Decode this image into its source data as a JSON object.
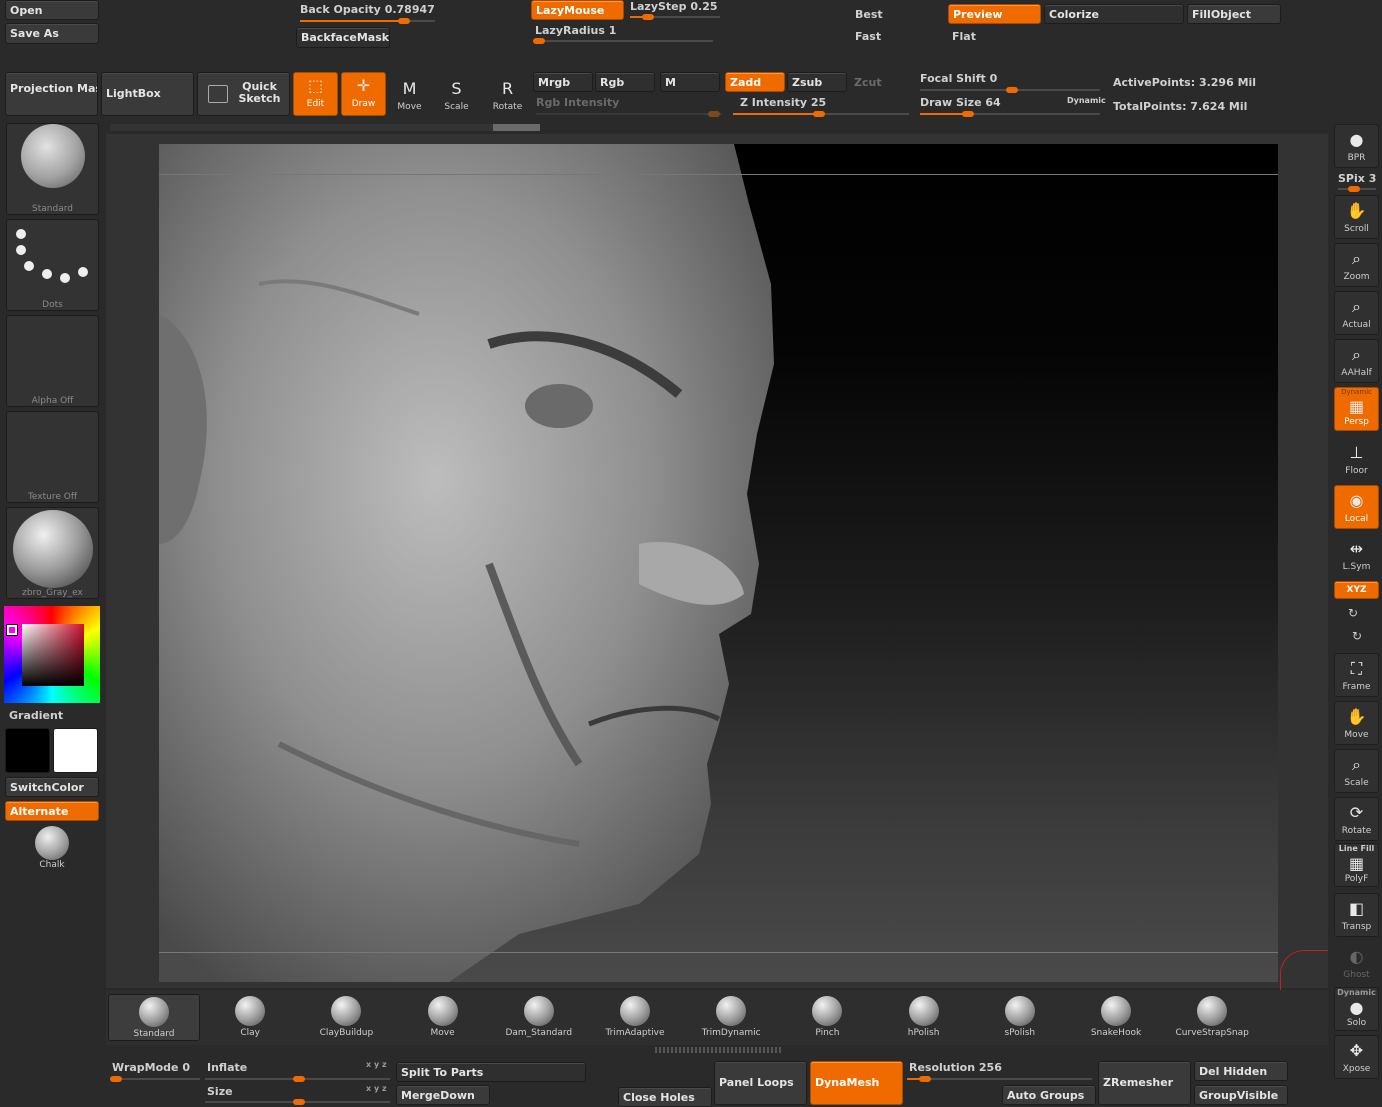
{
  "file_menu": {
    "open": "Open",
    "save_as": "Save As"
  },
  "top": {
    "back_opacity": {
      "label": "Back Opacity",
      "value": "0.78947",
      "fraction": 0.79
    },
    "backface_mask": "BackfaceMask",
    "lazymouse": "LazyMouse",
    "lazystep": {
      "label": "LazyStep",
      "value": "0.25",
      "fraction": 0.25
    },
    "lazyradius": {
      "label": "LazyRadius",
      "value": "1",
      "fraction": 0.0
    },
    "best": "Best",
    "fast": "Fast",
    "preview": "Preview",
    "flat": "Flat",
    "colorize": "Colorize",
    "fill_object": "FillObject"
  },
  "toolbar": {
    "projection_master": "Projection Master",
    "lightbox": "LightBox",
    "quick_sketch": "Quick Sketch",
    "edit": "Edit",
    "draw": "Draw",
    "move": "Move",
    "scale": "Scale",
    "rotate": "Rotate",
    "mrgb": "Mrgb",
    "rgb": "Rgb",
    "m": "M",
    "zadd": "Zadd",
    "zsub": "Zsub",
    "zcut": "Zcut",
    "rgb_intensity": "Rgb Intensity",
    "z_intensity": {
      "label": "Z Intensity",
      "value": "25",
      "fraction": 0.25
    },
    "focal_shift": {
      "label": "Focal Shift",
      "value": "0",
      "fraction": 0.5
    },
    "draw_size": {
      "label": "Draw Size",
      "value": "64",
      "fraction": 0.3
    },
    "dynamic": "Dynamic",
    "active_points": "ActivePoints: 3.296 Mil",
    "total_points": "TotalPoints: 7.624 Mil"
  },
  "left": {
    "brush": "Standard",
    "stroke": "Dots",
    "alpha": "Alpha  Off",
    "texture": "Texture  Off",
    "material": "zbro_Gray_ex",
    "gradient": "Gradient",
    "switch_color": "SwitchColor",
    "alternate": "Alternate",
    "chalk": "Chalk"
  },
  "right": {
    "bpr": "BPR",
    "spix": {
      "label": "SPix",
      "value": "3"
    },
    "scroll": "Scroll",
    "zoom": "Zoom",
    "actual": "Actual",
    "aahalf": "AAHalf",
    "dynamic_label": "Dynamic",
    "persp": "Persp",
    "floor": "Floor",
    "local": "Local",
    "lsym": "L.Sym",
    "xyz": "XYZ",
    "frame": "Frame",
    "move": "Move",
    "scale": "Scale",
    "rotate": "Rotate",
    "line_fill": "Line Fill",
    "polyf": "PolyF",
    "transp": "Transp",
    "ghost": "Ghost",
    "dynamic2": "Dynamic",
    "solo": "Solo",
    "xpose": "Xpose"
  },
  "brushes": [
    "Standard",
    "Clay",
    "ClayBuildup",
    "Move",
    "Dam_Standard",
    "TrimAdaptive",
    "TrimDynamic",
    "Pinch",
    "hPolish",
    "sPolish",
    "SnakeHook",
    "CurveStrapSnap"
  ],
  "bottom": {
    "wrapmode": {
      "label": "WrapMode",
      "value": "0",
      "fraction": 0.0
    },
    "inflate": "Inflate",
    "size": "Size",
    "split_to_parts": "Split To Parts",
    "merge_down": "MergeDown",
    "close_holes": "Close Holes",
    "panel_loops": "Panel Loops",
    "dynamesh": "DynaMesh",
    "resolution": {
      "label": "Resolution",
      "value": "256",
      "fraction": 0.1
    },
    "auto_groups": "Auto Groups",
    "zremesher": "ZRemesher",
    "del_hidden": "Del Hidden",
    "group_visible": "GroupVisible"
  },
  "colors": {
    "accent": "#ef6b00",
    "panel": "#2a2a2a",
    "button": "#3a3a3a"
  }
}
